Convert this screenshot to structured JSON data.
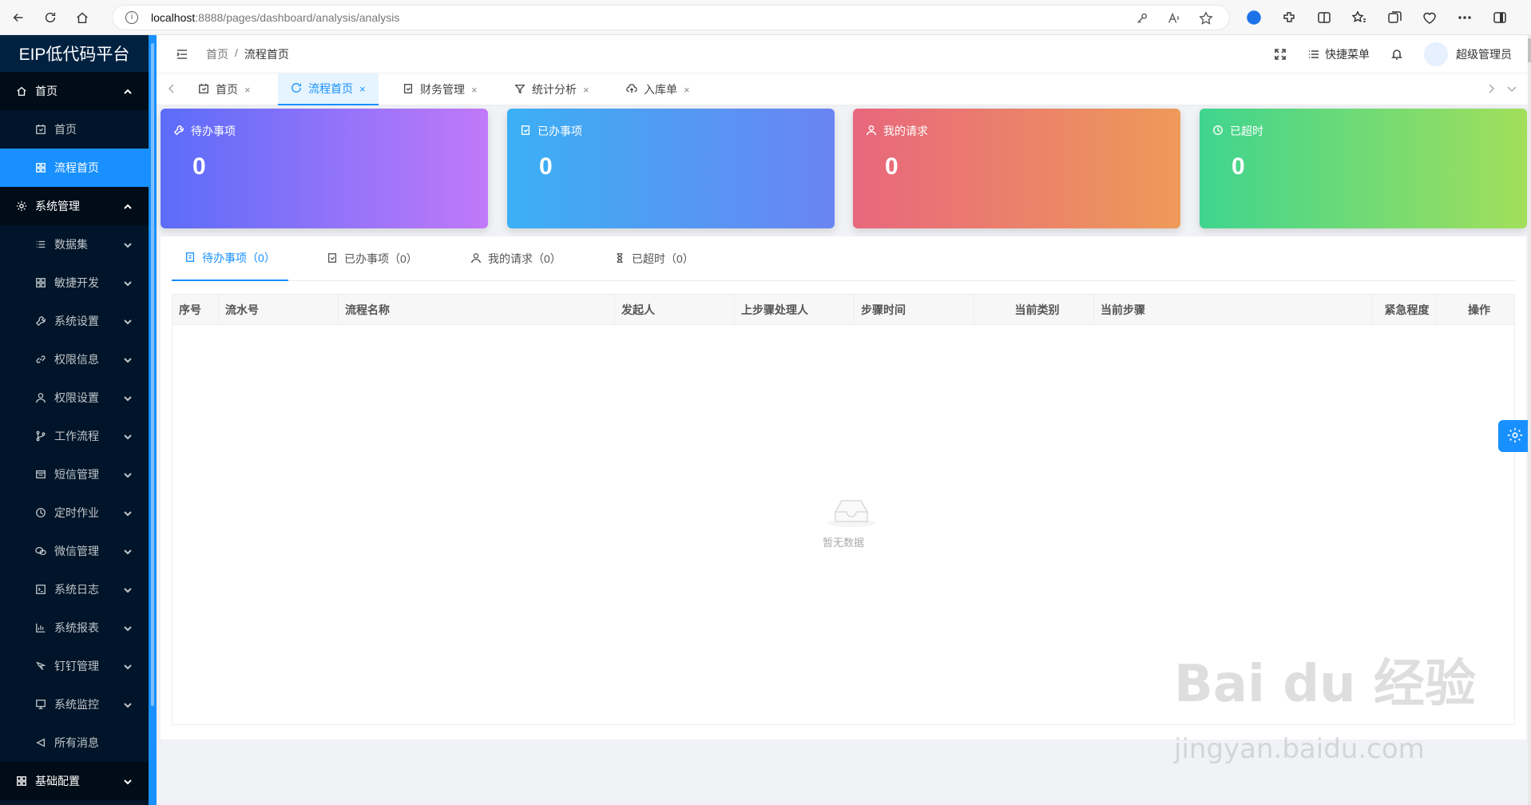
{
  "browser": {
    "url_host": "localhost",
    "url_path": ":8888/pages/dashboard/analysis/analysis"
  },
  "sidebar": {
    "logo": "EIP低代码平台",
    "groups": [
      {
        "label": "首页",
        "icon": "home-icon"
      },
      {
        "label": "系统管理",
        "icon": "gear-icon"
      },
      {
        "label": "基础配置",
        "icon": "grid-icon"
      }
    ],
    "items": [
      {
        "label": "首页",
        "icon": "calendar-icon"
      },
      {
        "label": "流程首页",
        "icon": "grid-icon"
      },
      {
        "label": "数据集",
        "icon": "list-icon"
      },
      {
        "label": "敏捷开发",
        "icon": "grid-icon"
      },
      {
        "label": "系统设置",
        "icon": "wrench-icon"
      },
      {
        "label": "权限信息",
        "icon": "link-icon"
      },
      {
        "label": "权限设置",
        "icon": "user-icon"
      },
      {
        "label": "工作流程",
        "icon": "branch-icon"
      },
      {
        "label": "短信管理",
        "icon": "sms-icon"
      },
      {
        "label": "定时作业",
        "icon": "clock-icon"
      },
      {
        "label": "微信管理",
        "icon": "wechat-icon"
      },
      {
        "label": "系统日志",
        "icon": "terminal-icon"
      },
      {
        "label": "系统报表",
        "icon": "chart-icon"
      },
      {
        "label": "钉钉管理",
        "icon": "pin-icon"
      },
      {
        "label": "系统监控",
        "icon": "monitor-icon"
      },
      {
        "label": "所有消息",
        "icon": "message-icon"
      }
    ]
  },
  "header": {
    "breadcrumb": [
      "首页",
      "/",
      "流程首页"
    ],
    "quick_menu": "快捷菜单",
    "user_name": "超级管理员"
  },
  "tabs": [
    {
      "label": "首页",
      "close": "×"
    },
    {
      "label": "流程首页",
      "close": "×"
    },
    {
      "label": "财务管理",
      "close": "×"
    },
    {
      "label": "统计分析",
      "close": "×"
    },
    {
      "label": "入库单",
      "close": "×"
    }
  ],
  "cards": [
    {
      "title": "待办事项",
      "value": "0"
    },
    {
      "title": "已办事项",
      "value": "0"
    },
    {
      "title": "我的请求",
      "value": "0"
    },
    {
      "title": "已超时",
      "value": "0"
    }
  ],
  "sub_tabs": [
    "待办事项（0）",
    "已办事项（0）",
    "我的请求（0）",
    "已超时（0）"
  ],
  "table": {
    "columns": [
      "序号",
      "流水号",
      "流程名称",
      "发起人",
      "上步骤处理人",
      "步骤时间",
      "当前类别",
      "当前步骤",
      "紧急程度",
      "操作"
    ],
    "empty_text": "暂无数据"
  },
  "watermark": {
    "main": "Bai du 经验",
    "sub": "jingyan.baidu.com"
  },
  "colors": {
    "accent": "#1890ff",
    "sidebar_bg": "#001529"
  }
}
